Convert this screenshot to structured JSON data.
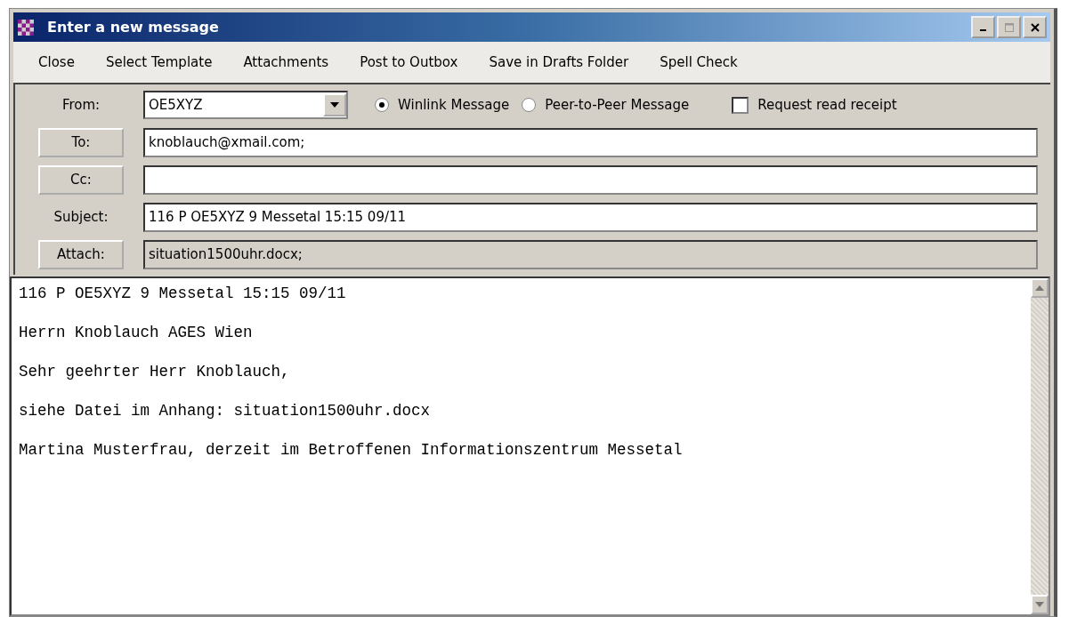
{
  "window": {
    "title": "Enter a new message"
  },
  "menu": [
    "Close",
    "Select Template",
    "Attachments",
    "Post to Outbox",
    "Save in Drafts Folder",
    "Spell Check"
  ],
  "from": {
    "label": "From:",
    "value": "OE5XYZ"
  },
  "message_type": [
    {
      "label": "Winlink Message",
      "selected": true
    },
    {
      "label": "Peer-to-Peer Message",
      "selected": false
    }
  ],
  "read_receipt": {
    "label": "Request read receipt",
    "checked": false
  },
  "to": {
    "label": "To:",
    "value": "knoblauch@xmail.com;"
  },
  "cc": {
    "label": "Cc:"
  },
  "subject": {
    "label": "Subject:",
    "value": "116 P OE5XYZ 9 Messetal 15:15 09/11"
  },
  "attach": {
    "label": "Attach:",
    "value": "situation1500uhr.docx;"
  },
  "body": [
    "116 P OE5XYZ 9 Messetal 15:15 09/11",
    "Herrn Knoblauch AGES Wien",
    "Sehr geehrter Herr Knoblauch,",
    "siehe Datei im Anhang: situation1500uhr.docx",
    "Martina Musterfrau, derzeit im Betroffenen Informationszentrum Messetal"
  ]
}
